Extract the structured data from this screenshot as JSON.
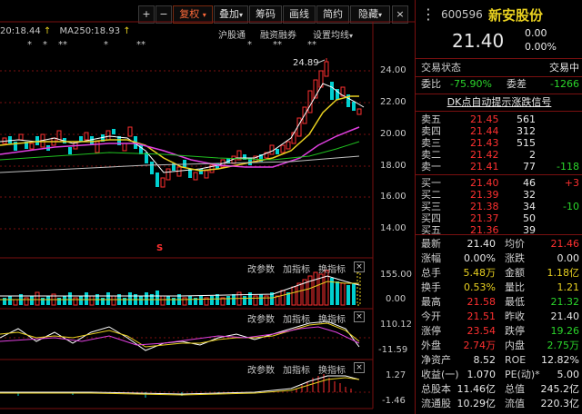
{
  "toolbar": {
    "plus": "+",
    "minus": "−",
    "adjust": "复权",
    "overlay": "叠加",
    "chips": "筹码",
    "draw": "画线",
    "brief": "简约",
    "hide": "隐藏",
    "close": "×"
  },
  "ma_legend": {
    "ma_val": "20:18.44",
    "ma250_label": "MA250:18.93",
    "arrow": "↑"
  },
  "markers": [
    "*",
    "*",
    "**",
    "*",
    "**",
    "*",
    "**",
    "**"
  ],
  "main_tabs": {
    "shhk": "沪股通",
    "margin": "融资融券",
    "set_ma": "设置均线"
  },
  "price_axis": [
    "24.00",
    "22.00",
    "20.00",
    "18.00",
    "16.00",
    "14.00"
  ],
  "peak_label": "24.89",
  "s_marker": "S",
  "sub_panels": [
    {
      "params": "改参数",
      "add": "加指标",
      "switch": "换指标",
      "axis": [
        "155.00",
        "0.00"
      ]
    },
    {
      "params": "改参数",
      "add": "加指标",
      "switch": "换指标",
      "axis": [
        "110.12",
        "-11.59"
      ]
    },
    {
      "params": "改参数",
      "add": "加指标",
      "switch": "换指标",
      "axis": [
        "1.27",
        "-1.46"
      ]
    }
  ],
  "stock": {
    "code": "600596",
    "name": "新安股份",
    "price": "21.40",
    "change": "0.00",
    "change_pct": "0.00%"
  },
  "trade_status": {
    "label": "交易状态",
    "value": "交易中"
  },
  "weibi": {
    "label": "委比",
    "value": "-75.90%",
    "label2": "委差",
    "value2": "-1266"
  },
  "dk_title": "DK点自动提示涨跌信号",
  "asks": [
    {
      "label": "卖五",
      "price": "21.45",
      "vol": "561",
      "chg": ""
    },
    {
      "label": "卖四",
      "price": "21.44",
      "vol": "312",
      "chg": ""
    },
    {
      "label": "卖三",
      "price": "21.43",
      "vol": "515",
      "chg": ""
    },
    {
      "label": "卖二",
      "price": "21.42",
      "vol": "2",
      "chg": ""
    },
    {
      "label": "卖一",
      "price": "21.41",
      "vol": "77",
      "chg": "-118"
    }
  ],
  "bids": [
    {
      "label": "买一",
      "price": "21.40",
      "vol": "46",
      "chg": "+3"
    },
    {
      "label": "买二",
      "price": "21.39",
      "vol": "32",
      "chg": ""
    },
    {
      "label": "买三",
      "price": "21.38",
      "vol": "34",
      "chg": "-10"
    },
    {
      "label": "买四",
      "price": "21.37",
      "vol": "50",
      "chg": ""
    },
    {
      "label": "买五",
      "price": "21.36",
      "vol": "39",
      "chg": ""
    }
  ],
  "stats": [
    {
      "l1": "最新",
      "v1": "21.40",
      "c1": "white",
      "l2": "均价",
      "v2": "21.46",
      "c2": "red"
    },
    {
      "l1": "涨幅",
      "v1": "0.00%",
      "c1": "white",
      "l2": "涨跌",
      "v2": "0.00",
      "c2": "white"
    },
    {
      "l1": "总手",
      "v1": "5.48万",
      "c1": "yellow",
      "l2": "金额",
      "v2": "1.18亿",
      "c2": "yellow"
    },
    {
      "l1": "换手",
      "v1": "0.53%",
      "c1": "yellow",
      "l2": "量比",
      "v2": "1.21",
      "c2": "yellow"
    },
    {
      "l1": "最高",
      "v1": "21.58",
      "c1": "red",
      "l2": "最低",
      "v2": "21.32",
      "c2": "green"
    },
    {
      "l1": "今开",
      "v1": "21.51",
      "c1": "red",
      "l2": "昨收",
      "v2": "21.40",
      "c2": "white"
    },
    {
      "l1": "涨停",
      "v1": "23.54",
      "c1": "red",
      "l2": "跌停",
      "v2": "19.26",
      "c2": "green"
    },
    {
      "l1": "外盘",
      "v1": "2.74万",
      "c1": "red",
      "l2": "内盘",
      "v2": "2.75万",
      "c2": "green"
    },
    {
      "l1": "净资产",
      "v1": "8.52",
      "c1": "white",
      "l2": "ROE",
      "v2": "12.82%",
      "c2": "white"
    },
    {
      "l1": "收益(一)",
      "v1": "1.070",
      "c1": "white",
      "l2": "PE(动)*",
      "v2": "5.00",
      "c2": "white"
    },
    {
      "l1": "总股本",
      "v1": "11.46亿",
      "c1": "white",
      "l2": "总值",
      "v2": "245.2亿",
      "c2": "white"
    },
    {
      "l1": "流通股",
      "v1": "10.29亿",
      "c1": "white",
      "l2": "流值",
      "v2": "220.3亿",
      "c2": "white"
    }
  ],
  "colors": {
    "up": "#ff3030",
    "down": "#00d0d0",
    "ma5": "#ffffff",
    "ma10": "#e8d020",
    "ma20": "#e040e0",
    "ma60": "#20c020",
    "border": "#7a1010"
  }
}
